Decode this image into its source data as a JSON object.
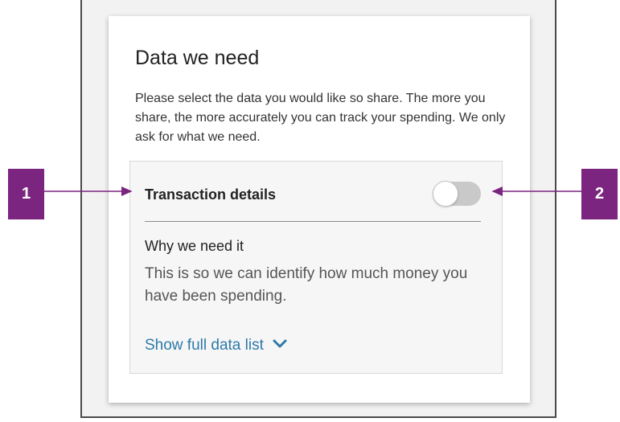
{
  "card": {
    "title": "Data we need",
    "intro": "Please select the data you would like so share. The more you share, the more accurately you can track your spending. We only ask for what we need."
  },
  "panel": {
    "title": "Transaction details",
    "toggle_on": false,
    "why_title": "Why we need it",
    "why_body": "This is so we can identify how much money you have been spending.",
    "show_link": "Show full data list"
  },
  "annotations": [
    {
      "label": "1"
    },
    {
      "label": "2"
    }
  ],
  "colors": {
    "badge": "#7b2580",
    "link": "#2d7aa8",
    "toggle_off": "#c9c9c9"
  },
  "icons": {
    "show_link": "chevron-down-icon"
  }
}
